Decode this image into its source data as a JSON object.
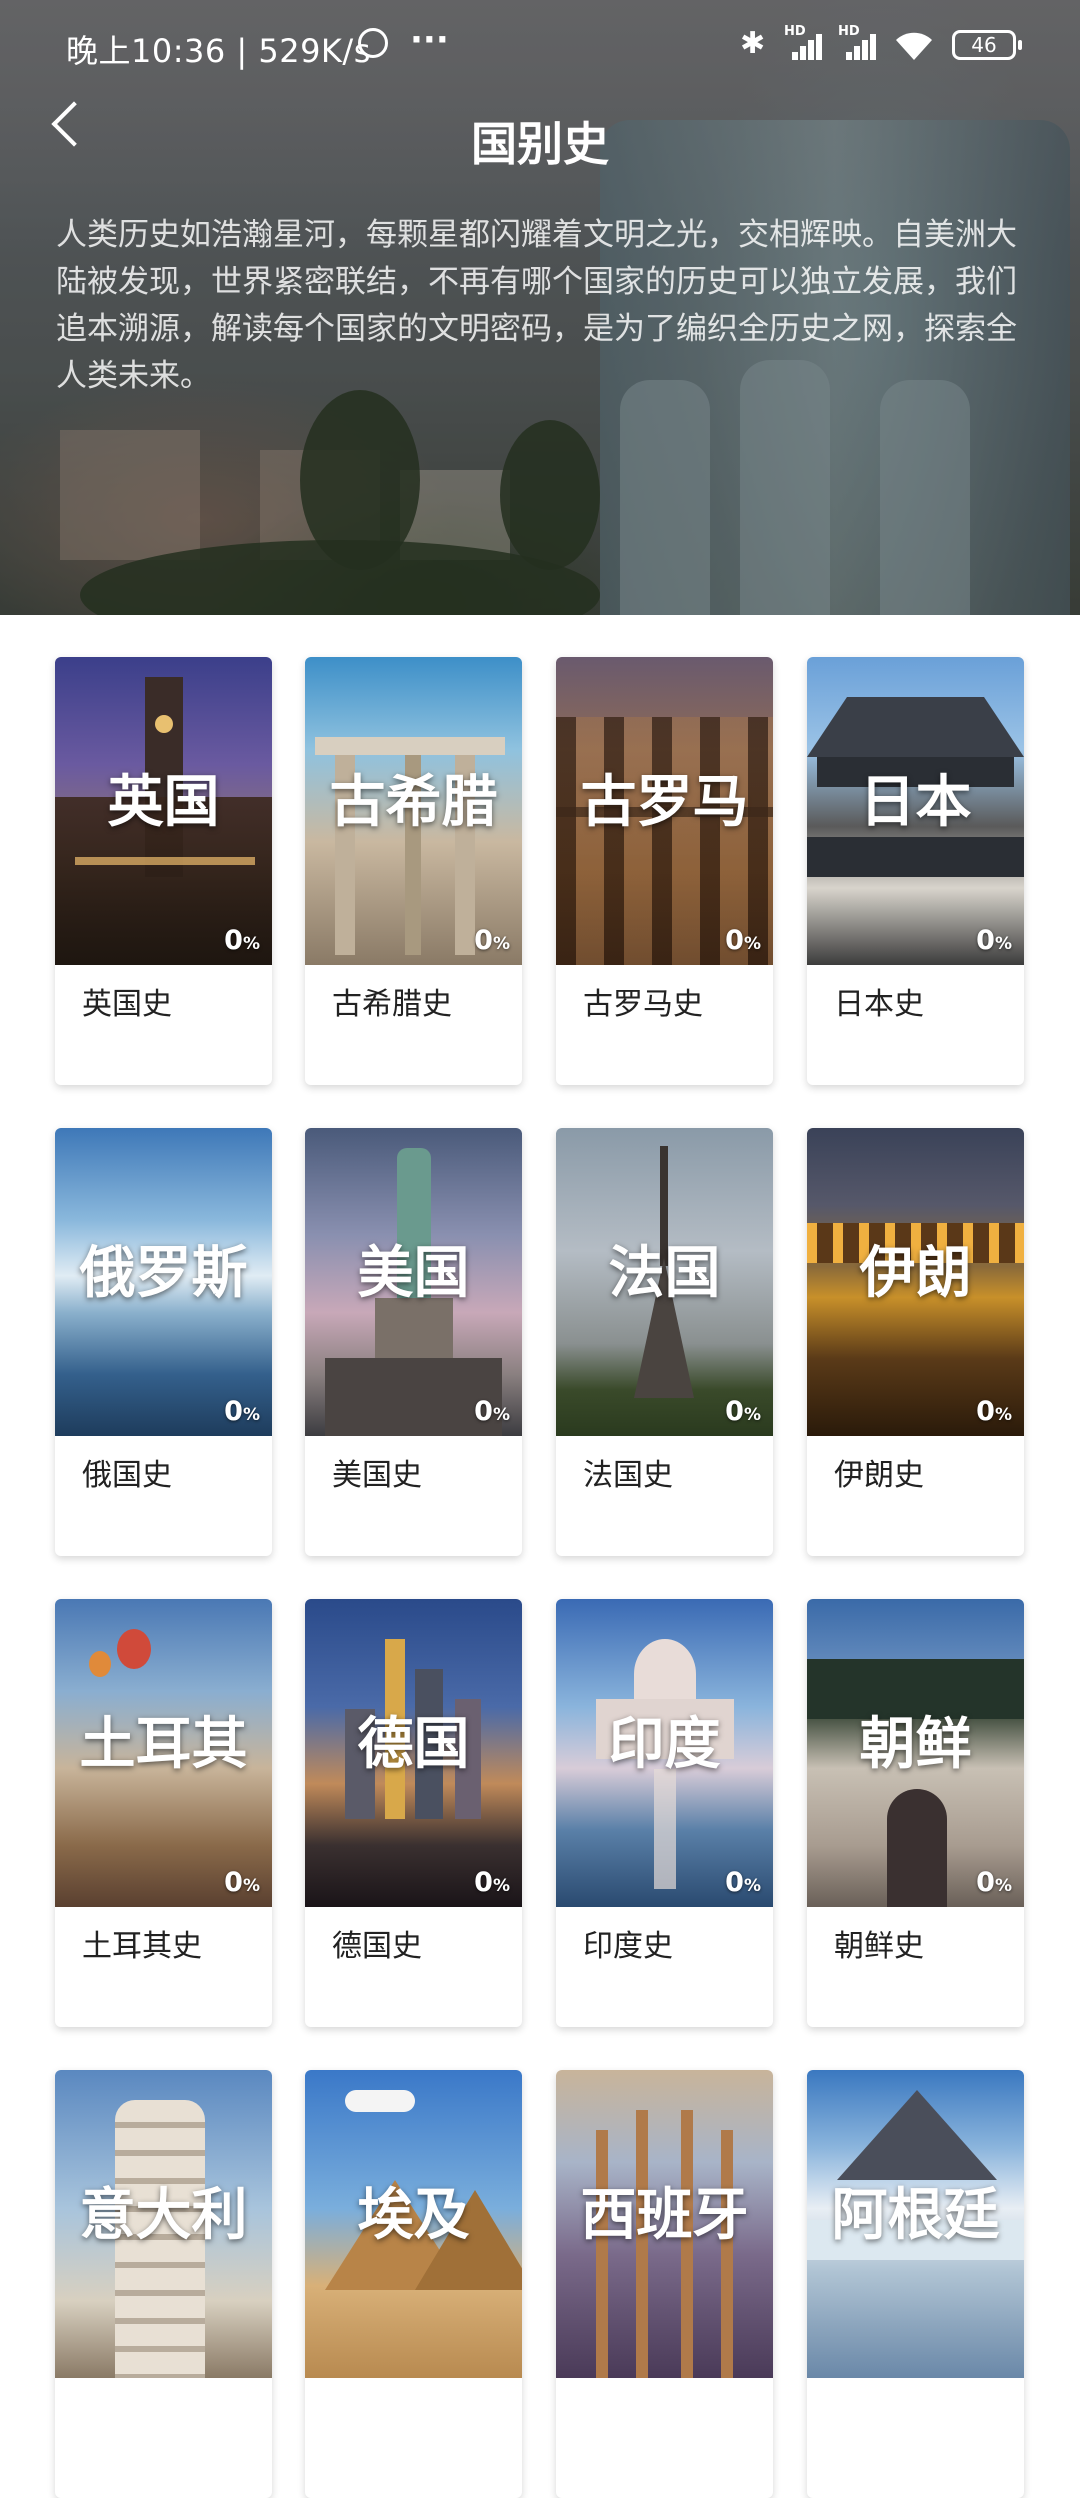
{
  "status_bar": {
    "time": "晚上10:36 | 529K/s",
    "more": "···",
    "bluetooth": "✱",
    "hd": "HD",
    "battery": "46"
  },
  "header": {
    "title": "国别史",
    "intro": "人类历史如浩瀚星河，每颗星都闪耀着文明之光，交相辉映。自美洲大陆被发现，世界紧密联结，不再有哪个国家的历史可以独立发展，我们追本溯源，解读每个国家的文明密码，是为了编织全历史之网，探索全人类未来。"
  },
  "cards": [
    {
      "name": "英国",
      "label": "英国史",
      "progress": "0",
      "unit": "%"
    },
    {
      "name": "古希腊",
      "label": "古希腊史",
      "progress": "0",
      "unit": "%"
    },
    {
      "name": "古罗马",
      "label": "古罗马史",
      "progress": "0",
      "unit": "%"
    },
    {
      "name": "日本",
      "label": "日本史",
      "progress": "0",
      "unit": "%"
    },
    {
      "name": "俄罗斯",
      "label": "俄国史",
      "progress": "0",
      "unit": "%"
    },
    {
      "name": "美国",
      "label": "美国史",
      "progress": "0",
      "unit": "%"
    },
    {
      "name": "法国",
      "label": "法国史",
      "progress": "0",
      "unit": "%"
    },
    {
      "name": "伊朗",
      "label": "伊朗史",
      "progress": "0",
      "unit": "%"
    },
    {
      "name": "土耳其",
      "label": "土耳其史",
      "progress": "0",
      "unit": "%"
    },
    {
      "name": "德国",
      "label": "德国史",
      "progress": "0",
      "unit": "%"
    },
    {
      "name": "印度",
      "label": "印度史",
      "progress": "0",
      "unit": "%"
    },
    {
      "name": "朝鲜",
      "label": "朝鲜史",
      "progress": "0",
      "unit": "%"
    },
    {
      "name": "意大利",
      "label": "",
      "progress": "",
      "unit": ""
    },
    {
      "name": "埃及",
      "label": "",
      "progress": "",
      "unit": ""
    },
    {
      "name": "西班牙",
      "label": "",
      "progress": "",
      "unit": ""
    },
    {
      "name": "阿根廷",
      "label": "",
      "progress": "",
      "unit": ""
    }
  ]
}
